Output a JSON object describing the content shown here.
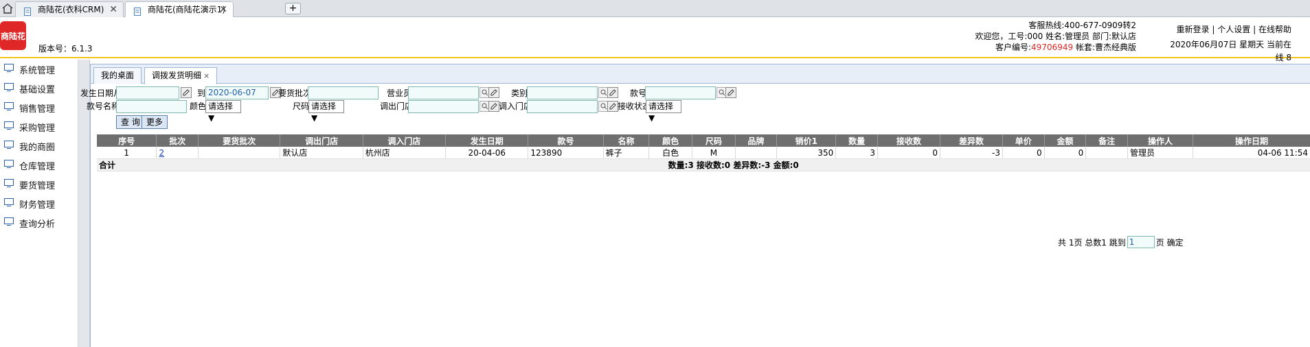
{
  "browser": {
    "tabs": [
      {
        "title": "商陆花(衣科CRM)"
      },
      {
        "title": "商陆花(商陆花演示1)"
      }
    ],
    "new_tab_label": "+"
  },
  "header": {
    "logo_text": "商陆花",
    "version": "版本号：6.1.3",
    "hotline": "客服热线:400-677-0909转2",
    "welcome": "欢迎您，工号:000 姓名:管理员 部门:默认店",
    "customer_label": "客户编号:",
    "customer_no": "49706949",
    "account_set": "帐套:曹杰经典版",
    "links": {
      "relogin": "重新登录",
      "settings": "个人设置",
      "help": "在线帮助",
      "sep": "|"
    },
    "date_online": "2020年06月07日 星期天 当前在线 8"
  },
  "sidebar": {
    "items": [
      {
        "label": "系统管理"
      },
      {
        "label": "基础设置"
      },
      {
        "label": "销售管理"
      },
      {
        "label": "采购管理"
      },
      {
        "label": "我的商圈"
      },
      {
        "label": "仓库管理"
      },
      {
        "label": "要货管理"
      },
      {
        "label": "财务管理"
      },
      {
        "label": "查询分析"
      }
    ]
  },
  "content_tabs": {
    "home": "我的桌面",
    "current": "调拨发货明细",
    "close": "×"
  },
  "filters": {
    "date_from_label": "发生日期从",
    "date_from_value": "",
    "date_to_label": "到",
    "date_to_value": "2020-06-07",
    "batch_label": "要货批次",
    "batch_value": "",
    "salesman_label": "营业员",
    "category_label": "类别",
    "style_no_label": "款号",
    "style_name_label": "款号名称",
    "color_label": "颜色",
    "color_value": "请选择",
    "size_label": "尺码",
    "size_value": "请选择",
    "out_store_label": "调出门店",
    "in_store_label": "调入门店",
    "recv_status_label": "接收状态",
    "recv_status_value": "请选择",
    "query_button": "查 询",
    "more_button": "更多"
  },
  "table": {
    "headers": [
      "序号",
      "批次",
      "要货批次",
      "调出门店",
      "调入门店",
      "发生日期",
      "款号",
      "名称",
      "颜色",
      "尺码",
      "品牌",
      "销价1",
      "数量",
      "接收数",
      "差异数",
      "单价",
      "金额",
      "备注",
      "操作人",
      "操作日期"
    ],
    "rows": [
      [
        "1",
        "2",
        "",
        "默认店",
        "杭州店",
        "20-04-06",
        "123890",
        "裤子",
        "白色",
        "M",
        "",
        "350",
        "3",
        "0",
        "-3",
        "0",
        "0",
        "",
        "管理员",
        "04-06 11:54"
      ]
    ],
    "summary_label": "合计",
    "summary_text": "数量:3 接收数:0 差异数:-3 金额:0"
  },
  "pager": {
    "total_pages": "共 1页",
    "total_count": "总数1",
    "goto_label": "跳到",
    "goto_value": "1",
    "page_unit": "页",
    "confirm": "确定"
  },
  "colors": {
    "accent_red": "#e02727",
    "header_rule": "#f0c419",
    "table_header": "#6f6f6f",
    "input_bg": "#f1fbf9"
  }
}
